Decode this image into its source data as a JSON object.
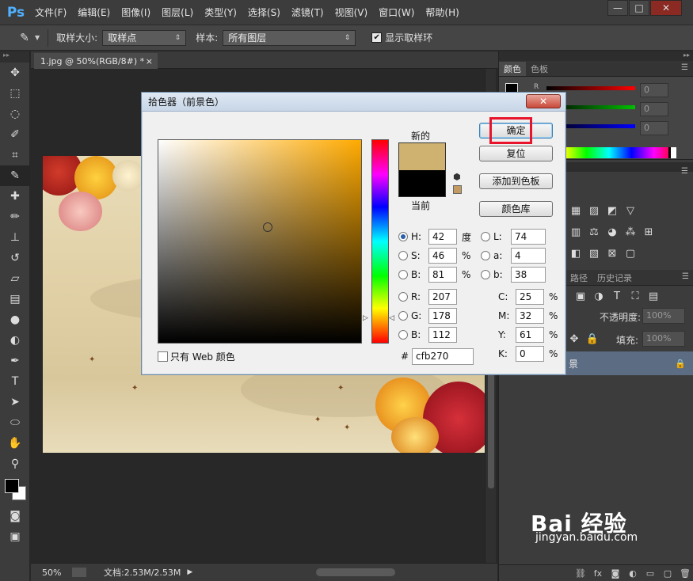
{
  "app": {
    "logo": "Ps",
    "menu": [
      "文件(F)",
      "编辑(E)",
      "图像(I)",
      "图层(L)",
      "类型(Y)",
      "选择(S)",
      "滤镜(T)",
      "视图(V)",
      "窗口(W)",
      "帮助(H)"
    ],
    "window_buttons": [
      "—",
      "□",
      "✕"
    ]
  },
  "options_bar": {
    "sample_size_label": "取样大小:",
    "sample_size_value": "取样点",
    "sample_label": "样本:",
    "sample_value": "所有图层",
    "show_ring_label": "显示取样环",
    "show_ring_checked": true
  },
  "document": {
    "tab_title": "1.jpg @ 50%(RGB/8#) *",
    "tab_close": "×"
  },
  "status_bar": {
    "zoom": "50%",
    "doc_size": "文档:2.53M/2.53M"
  },
  "color_panel": {
    "tabs": [
      "颜色",
      "色板"
    ],
    "channel_r": "R",
    "values": [
      "0",
      "0",
      "0"
    ],
    "colors": {
      "r": "#ff0000",
      "g": "#00c000",
      "b": "#0000ff"
    }
  },
  "layers_panel": {
    "tabs": [
      "路径",
      "历史记录"
    ],
    "opacity_label": "不透明度:",
    "opacity_value": "100%",
    "fill_label": "填充:",
    "fill_value": "100%",
    "layer_name": "背景",
    "layer_partial_label": "景"
  },
  "dialog": {
    "title": "拾色器（前景色）",
    "close": "✕",
    "new_label": "新的",
    "current_label": "当前",
    "new_color": "#cfb270",
    "current_color": "#000000",
    "buttons": {
      "ok": "确定",
      "reset": "复位",
      "add_swatch": "添加到色板",
      "library": "颜色库"
    },
    "fields": {
      "H": {
        "label": "H:",
        "value": "42",
        "unit": "度"
      },
      "S": {
        "label": "S:",
        "value": "46",
        "unit": "%"
      },
      "Bv": {
        "label": "B:",
        "value": "81",
        "unit": "%"
      },
      "R": {
        "label": "R:",
        "value": "207",
        "unit": ""
      },
      "G": {
        "label": "G:",
        "value": "178",
        "unit": ""
      },
      "Bc": {
        "label": "B:",
        "value": "112",
        "unit": ""
      },
      "L": {
        "label": "L:",
        "value": "74",
        "unit": ""
      },
      "a": {
        "label": "a:",
        "value": "4",
        "unit": ""
      },
      "b": {
        "label": "b:",
        "value": "38",
        "unit": ""
      },
      "C": {
        "label": "C:",
        "value": "25",
        "unit": "%"
      },
      "M": {
        "label": "M:",
        "value": "32",
        "unit": "%"
      },
      "Y": {
        "label": "Y:",
        "value": "61",
        "unit": "%"
      },
      "K": {
        "label": "K:",
        "value": "0",
        "unit": "%"
      }
    },
    "hex_hash": "#",
    "hex_value": "cfb270",
    "web_only_label": "只有 Web 颜色"
  },
  "watermark": {
    "brand": "Bai 经验",
    "url": "jingyan.baidu.com"
  }
}
